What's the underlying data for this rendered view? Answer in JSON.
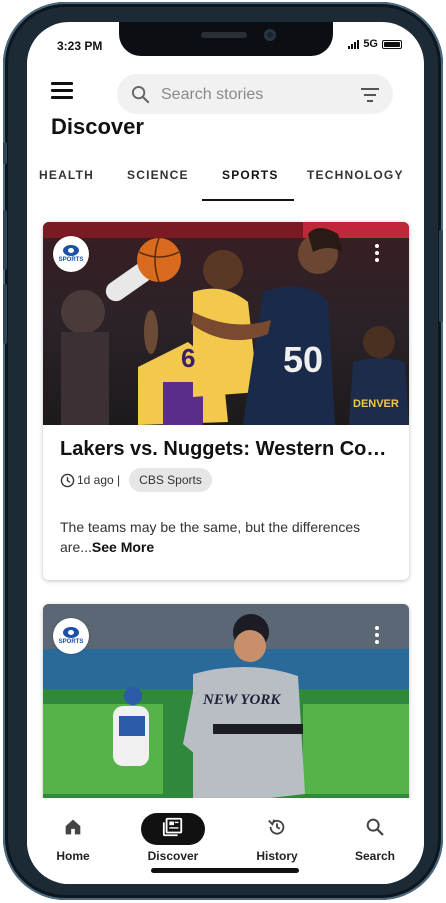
{
  "status_bar": {
    "time": "3:23 PM",
    "network": "5G"
  },
  "search": {
    "placeholder": "Search stories"
  },
  "page_title": "Discover",
  "tabs": [
    {
      "label": "HEALTH"
    },
    {
      "label": "SCIENCE"
    },
    {
      "label": "SPORTS",
      "active": true
    },
    {
      "label": "TECHNOLOGY"
    }
  ],
  "articles": [
    {
      "source_logo_text": "SPORTS",
      "headline": "Lakers vs. Nuggets: Western Conference Finals",
      "time_ago": "1d ago |",
      "source": "CBS Sports",
      "snippet": "The teams may be the same, but the differences are...",
      "see_more": "See More",
      "jersey_numbers": [
        "6",
        "50"
      ],
      "jersey_text": "DENVER"
    },
    {
      "source_logo_text": "SPORTS",
      "jersey_text": "NEW YORK"
    }
  ],
  "bottom_nav": [
    {
      "label": "Home",
      "icon": "home-icon"
    },
    {
      "label": "Discover",
      "icon": "newspaper-icon",
      "active": true
    },
    {
      "label": "History",
      "icon": "history-icon"
    },
    {
      "label": "Search",
      "icon": "search-icon"
    }
  ],
  "colors": {
    "accent": "#111111",
    "chip_bg": "#e6e6e6",
    "search_bg": "#f1f1f1",
    "logo_blue": "#1c4fa8"
  }
}
